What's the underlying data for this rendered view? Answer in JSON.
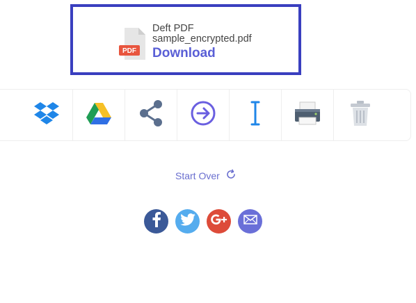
{
  "download_card": {
    "app_name": "Deft PDF",
    "file_name": "sample_encrypted.pdf",
    "download_label": "Download",
    "file_badge": "PDF"
  },
  "toolbar": {
    "items": [
      {
        "name": "dropbox",
        "icon": "dropbox-icon"
      },
      {
        "name": "google-drive",
        "icon": "google-drive-icon"
      },
      {
        "name": "share",
        "icon": "share-icon"
      },
      {
        "name": "continue",
        "icon": "arrow-right-circle-icon"
      },
      {
        "name": "edit-text",
        "icon": "text-cursor-icon"
      },
      {
        "name": "print",
        "icon": "printer-icon"
      },
      {
        "name": "delete",
        "icon": "trash-icon"
      }
    ]
  },
  "start_over": {
    "label": "Start Over",
    "icon": "refresh-icon"
  },
  "social": [
    {
      "name": "facebook",
      "color": "#3b5998"
    },
    {
      "name": "twitter",
      "color": "#55acee"
    },
    {
      "name": "google-plus",
      "color": "#dd4b39"
    },
    {
      "name": "email",
      "color": "#6a6fd8"
    }
  ],
  "colors": {
    "accent": "#5a5fd6",
    "card_border": "#3a3fbf"
  }
}
